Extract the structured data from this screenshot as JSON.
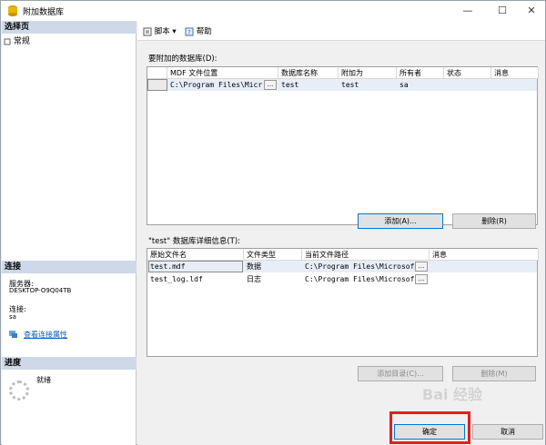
{
  "window": {
    "title": "附加数据库",
    "controls": [
      "—",
      "☐",
      "✕"
    ]
  },
  "left": {
    "select_page_header": "选择页",
    "select_items": [
      {
        "label": "常规"
      }
    ],
    "connection_header": "连接",
    "server_label": "服务器:",
    "server_value": "DESKTOP-O9Q04TB",
    "connect_label": "连接:",
    "connect_value": "sa",
    "view_conn_props": "查看连接属性",
    "progress_header": "进度",
    "progress_status": "就绪"
  },
  "toolbar": {
    "script_label": "脚本",
    "help_label": "帮助"
  },
  "attach": {
    "label": "要附加的数据库(D):",
    "columns": [
      "MDF 文件位置",
      "数据库名称",
      "附加为",
      "所有者",
      "状态",
      "消息"
    ],
    "rows": [
      {
        "mdf": "C:\\Program Files\\Micr...",
        "dbname": "test",
        "attach_as": "test",
        "owner": "sa",
        "status": "",
        "message": ""
      }
    ],
    "add_button": "添加(A)...",
    "remove_button": "删除(R)"
  },
  "details": {
    "label": "\"test\" 数据库详细信息(T):",
    "columns": [
      "原始文件名",
      "文件类型",
      "当前文件路径",
      "消息"
    ],
    "rows": [
      {
        "name": "test.mdf",
        "type": "数据",
        "path": "C:\\Program Files\\Microsof...",
        "message": ""
      },
      {
        "name": "test_log.ldf",
        "type": "日志",
        "path": "C:\\Program Files\\Microsof...",
        "message": ""
      }
    ],
    "add_catalog_button": "添加目录(C)...",
    "remove_button": "删除(M)"
  },
  "footer": {
    "ok_button": "确定",
    "cancel_button": "取消"
  },
  "watermark": "Bai 经验",
  "colors": {
    "accent": "#0078d7",
    "section_header": "#cfd8e8",
    "highlight": "#e02020"
  }
}
